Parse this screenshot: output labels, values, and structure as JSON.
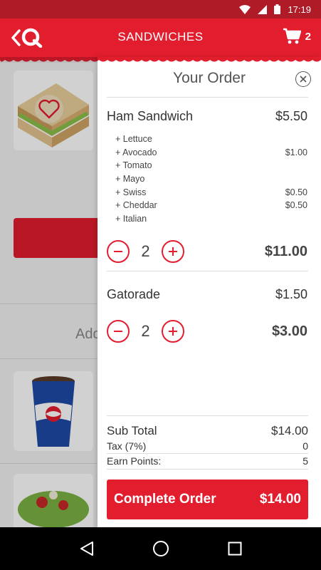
{
  "status_bar": {
    "time": "17:19"
  },
  "app_bar": {
    "title": "SANDWICHES",
    "cart_count": "2"
  },
  "background": {
    "add_text": "Add"
  },
  "order": {
    "title": "Your Order",
    "items": [
      {
        "name": "Ham Sandwich",
        "price": "$5.50",
        "modifiers": [
          {
            "label": "+ Lettuce",
            "price": ""
          },
          {
            "label": "+ Avocado",
            "price": "$1.00"
          },
          {
            "label": "+ Tomato",
            "price": ""
          },
          {
            "label": "+ Mayo",
            "price": ""
          },
          {
            "label": "+ Swiss",
            "price": "$0.50"
          },
          {
            "label": "+ Cheddar",
            "price": "$0.50"
          },
          {
            "label": "+ Italian",
            "price": ""
          }
        ],
        "quantity": "2",
        "line_total": "$11.00"
      },
      {
        "name": "Gatorade",
        "price": "$1.50",
        "modifiers": [],
        "quantity": "2",
        "line_total": "$3.00"
      }
    ],
    "summary": {
      "subtotal_label": "Sub Total",
      "subtotal_value": "$14.00",
      "tax_label": "Tax (7%)",
      "tax_value": "0",
      "points_label": "Earn Points:",
      "points_value": "5"
    },
    "complete_label": "Complete Order",
    "complete_total": "$14.00"
  },
  "colors": {
    "brand_red": "#e21d2e",
    "status_red": "#b01b28"
  },
  "icons": [
    "wifi-icon",
    "signal-icon",
    "battery-icon",
    "back-chevron-icon",
    "logo-q-icon",
    "cart-icon",
    "close-icon",
    "minus-icon",
    "plus-icon",
    "heart-icon",
    "nav-back-icon",
    "nav-home-icon",
    "nav-recents-icon"
  ]
}
